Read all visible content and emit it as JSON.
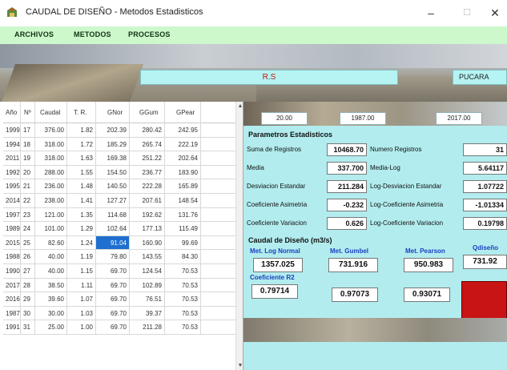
{
  "window": {
    "title": "CAUDAL DE DISEÑO - Metodos Estadisticos",
    "min": "–",
    "max": "☐",
    "close": "✕"
  },
  "menu": [
    "ARCHIVOS",
    "METODOS",
    "PROCESOS"
  ],
  "banner": {
    "rs_value": "R.S",
    "station_value": "PUCARA"
  },
  "table": {
    "headers": [
      "Año",
      "Nº",
      "Caudal",
      "T. R.",
      "GNor",
      "GGum",
      "GPear"
    ],
    "rows": [
      [
        "1999",
        "17",
        "376.00",
        "1.82",
        "202.39",
        "280.42",
        "242.95"
      ],
      [
        "1994",
        "18",
        "318.00",
        "1.72",
        "185.29",
        "265.74",
        "222.19"
      ],
      [
        "2011",
        "19",
        "318.00",
        "1.63",
        "169.38",
        "251.22",
        "202.64"
      ],
      [
        "1992",
        "20",
        "288.00",
        "1.55",
        "154.50",
        "236.77",
        "183.90"
      ],
      [
        "1995",
        "21",
        "236.00",
        "1.48",
        "140.50",
        "222.28",
        "165.89"
      ],
      [
        "2014",
        "22",
        "238.00",
        "1.41",
        "127.27",
        "207.61",
        "148.54"
      ],
      [
        "1997",
        "23",
        "121.00",
        "1.35",
        "114.68",
        "192.62",
        "131.76"
      ],
      [
        "1989",
        "24",
        "101.00",
        "1.29",
        "102.64",
        "177.13",
        "115.49"
      ],
      [
        "2015",
        "25",
        "82.60",
        "1.24",
        "91.04",
        "160.90",
        "99.69"
      ],
      [
        "1988",
        "26",
        "40.00",
        "1.19",
        "79.80",
        "143.55",
        "84.30"
      ],
      [
        "1990",
        "27",
        "40.00",
        "1.15",
        "69.70",
        "124.54",
        "70.53"
      ],
      [
        "2017",
        "28",
        "38.50",
        "1.11",
        "69.70",
        "102.89",
        "70.53"
      ],
      [
        "2016",
        "29",
        "39.60",
        "1.07",
        "69.70",
        "76.51",
        "70.53"
      ],
      [
        "1987",
        "30",
        "30.00",
        "1.03",
        "69.70",
        "39.37",
        "70.53"
      ],
      [
        "1991",
        "31",
        "25.00",
        "1.00",
        "69.70",
        "211.28",
        "70.53"
      ]
    ],
    "selected": {
      "row": 8,
      "col": 4
    }
  },
  "years": {
    "inputs": [
      "20.00",
      "1987.00",
      "2017.00"
    ]
  },
  "params": {
    "title": "Parametros Estadisticos",
    "left": [
      {
        "label": "Suma de Registros",
        "value": "10468.70"
      },
      {
        "label": "Media",
        "value": "337.700"
      },
      {
        "label": "Desviacion Estandar",
        "value": "211.284"
      },
      {
        "label": "Coeficiente Asimetria",
        "value": "-0.232"
      },
      {
        "label": "Coeficiente Variacion",
        "value": "0.626"
      }
    ],
    "right": [
      {
        "label": "Numero Registros",
        "value": "31"
      },
      {
        "label": "Media-Log",
        "value": "5.64117"
      },
      {
        "label": "Log-Desviacion Estandar",
        "value": "1.07722"
      },
      {
        "label": "Log-Coeficiente Asimetria",
        "value": "-1.01334"
      },
      {
        "label": "Log-Coeficiente Variacion",
        "value": "0.19798"
      }
    ]
  },
  "design": {
    "title": "Caudal de Diseño (m3/s)",
    "methods": [
      {
        "label": "Met. Log Normal",
        "value": "1357.025"
      },
      {
        "label": "Met. Gumbel",
        "value": "731.916"
      },
      {
        "label": "Met. Pearson",
        "value": "950.983"
      }
    ],
    "qdiseno_label": "Qdiseño",
    "qdiseno_value": "731.92",
    "r2_title": "Coeficiente R2",
    "r2_values": [
      "0.79714",
      "0.97073",
      "0.93071"
    ]
  }
}
